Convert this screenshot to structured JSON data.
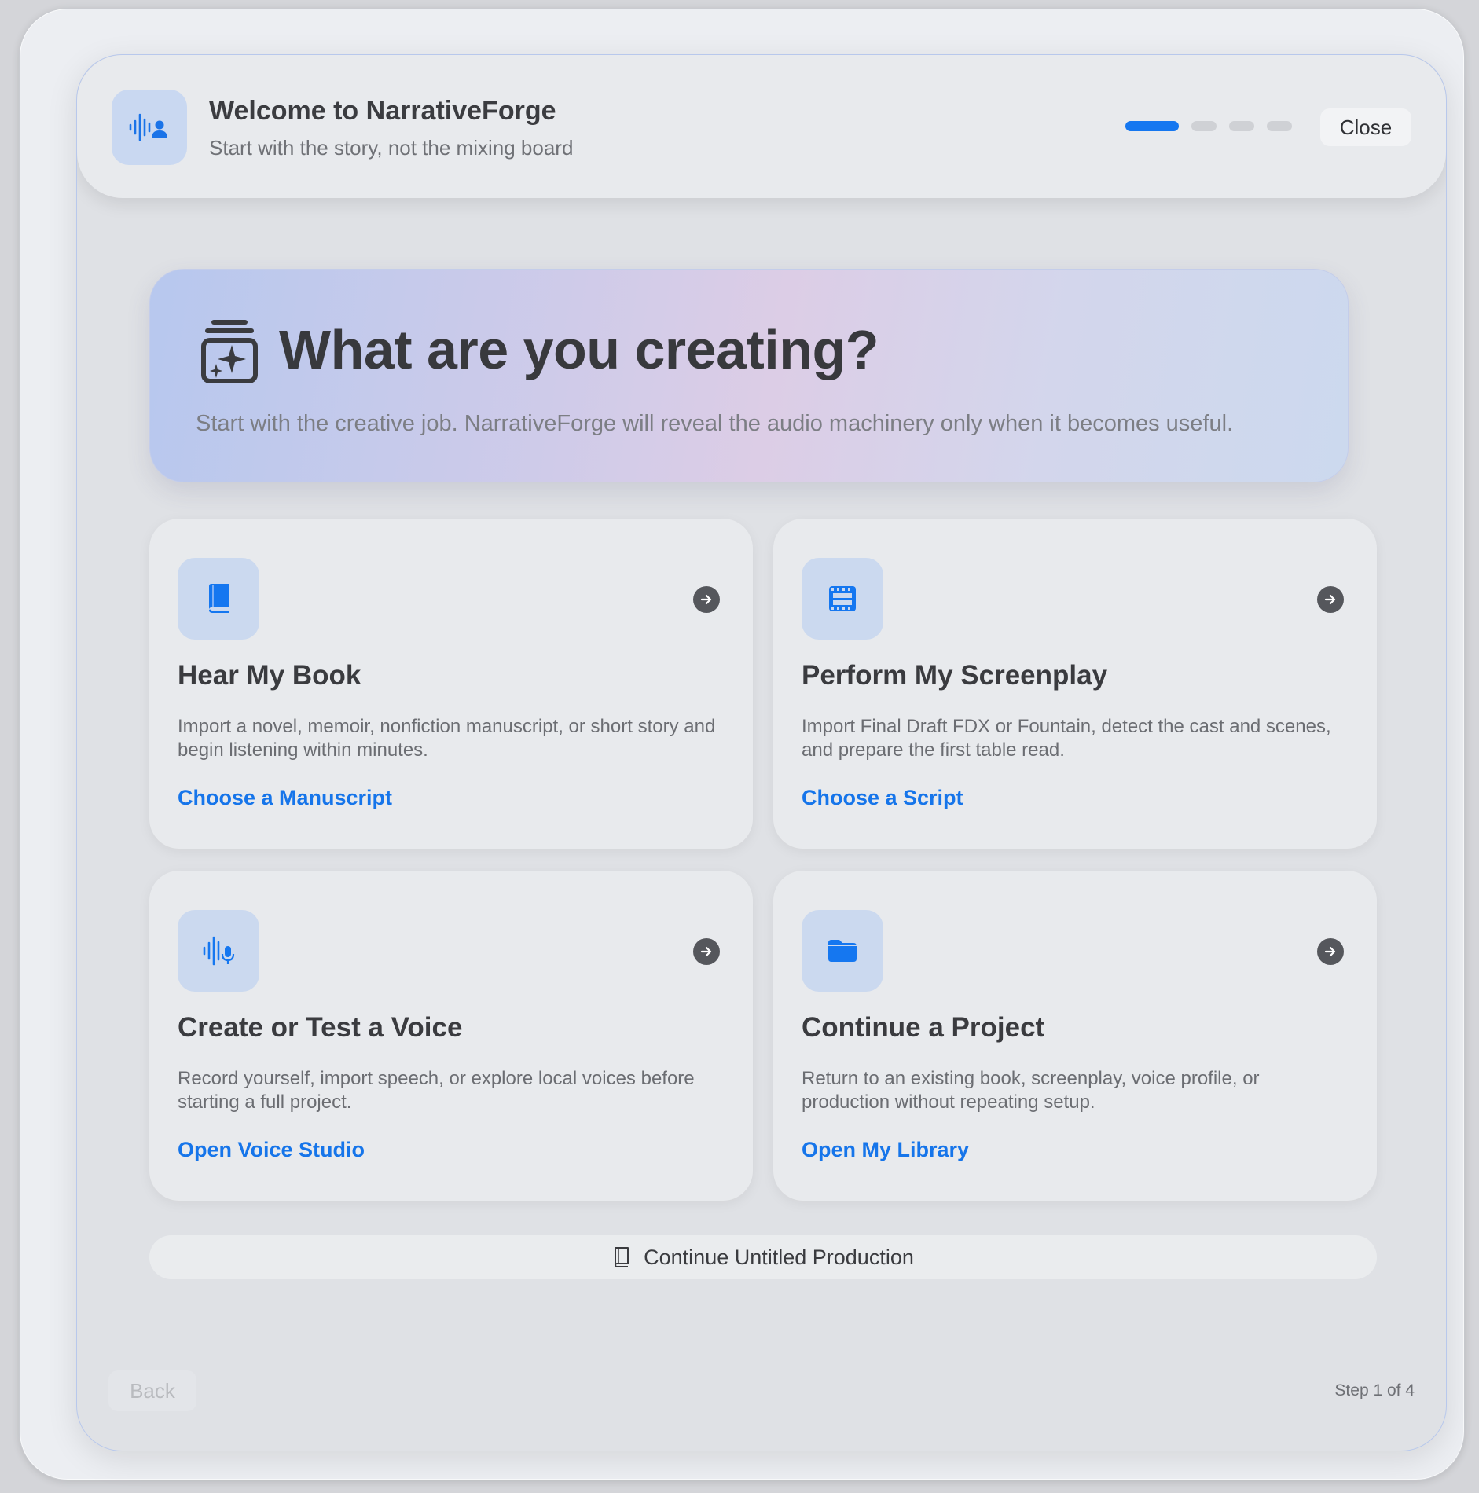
{
  "header": {
    "title": "Welcome to NarrativeForge",
    "subtitle": "Start with the story, not the mixing board",
    "close_label": "Close",
    "progress": {
      "current_step": 1,
      "total_steps": 4
    }
  },
  "hero": {
    "title": "What are you creating?",
    "subtitle": "Start with the creative job. NarrativeForge will reveal the audio machinery only when it becomes useful."
  },
  "cards": [
    {
      "icon": "book-icon",
      "title": "Hear My Book",
      "description": "Import a novel, memoir, nonfiction manuscript, or short story and begin listening within minutes.",
      "link": "Choose a Manuscript"
    },
    {
      "icon": "film-icon",
      "title": "Perform My Screenplay",
      "description": "Import Final Draft FDX or Fountain, detect the cast and scenes, and prepare the first table read.",
      "link": "Choose a Script"
    },
    {
      "icon": "waveform-mic-icon",
      "title": "Create or Test a Voice",
      "description": "Record yourself, import speech, or explore local voices before starting a full project.",
      "link": "Open Voice Studio"
    },
    {
      "icon": "folder-icon",
      "title": "Continue a Project",
      "description": "Return to an existing book, screenplay, voice profile, or production without repeating setup.",
      "link": "Open My Library"
    }
  ],
  "continue_production": {
    "label": "Continue Untitled Production",
    "icon": "book-outline-icon"
  },
  "footer": {
    "back_label": "Back",
    "step_label": "Step 1 of 4"
  },
  "colors": {
    "accent": "#1577f0",
    "icon_tile": "#cbd9ef"
  }
}
